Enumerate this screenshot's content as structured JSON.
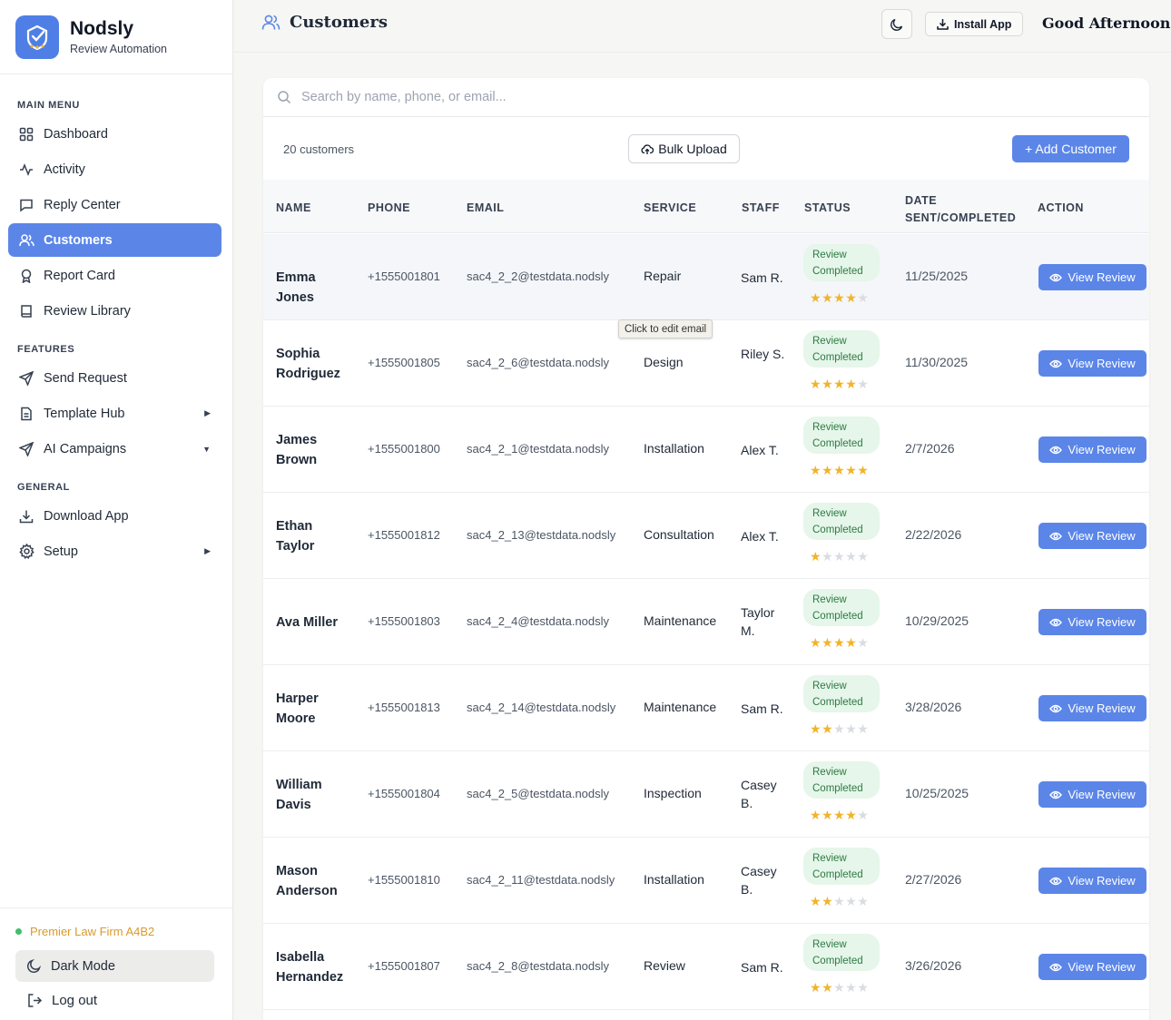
{
  "brand": {
    "name": "Nodsly",
    "subtitle": "Review Automation"
  },
  "sidebar": {
    "sections": [
      {
        "label": "MAIN MENU"
      },
      {
        "label": "FEATURES"
      },
      {
        "label": "GENERAL"
      }
    ],
    "items": [
      {
        "label": "Dashboard",
        "icon": "grid-icon"
      },
      {
        "label": "Activity",
        "icon": "activity-icon"
      },
      {
        "label": "Reply Center",
        "icon": "message-icon"
      },
      {
        "label": "Customers",
        "icon": "users-icon",
        "active": true
      },
      {
        "label": "Report Card",
        "icon": "award-icon"
      },
      {
        "label": "Review Library",
        "icon": "book-icon"
      },
      {
        "label": "Send Request",
        "icon": "send-icon"
      },
      {
        "label": "Template Hub",
        "icon": "file-icon"
      },
      {
        "label": "AI Campaigns",
        "icon": "send-icon"
      },
      {
        "label": "Download App",
        "icon": "download-icon"
      },
      {
        "label": "Setup",
        "icon": "gear-icon"
      }
    ],
    "firm": "Premier Law Firm A4B2",
    "dark_mode": "Dark Mode",
    "logout": "Log out"
  },
  "header": {
    "title": "Customers",
    "install": "Install App",
    "greeting": "Good Afternoon!"
  },
  "toolbar": {
    "search_placeholder": "Search by name, phone, or email...",
    "count": "20 customers",
    "bulk_upload": "Bulk Upload",
    "add_customer": "+ Add Customer"
  },
  "table": {
    "columns": [
      "NAME",
      "PHONE",
      "EMAIL",
      "SERVICE",
      "STAFF",
      "STATUS",
      "DATE SENT/COMPLETED",
      "ACTION"
    ],
    "rows": [
      {
        "name": "Emma Jones",
        "phone": "+1555001801",
        "email": "sac4_2_2@testdata.nodsly",
        "service": "Repair",
        "staff": "Sam R.",
        "status": "Review Completed",
        "rating": 4,
        "date": "11/25/2025",
        "action": "View Review"
      },
      {
        "name": "Sophia Rodriguez",
        "phone": "+1555001805",
        "email": "sac4_2_6@testdata.nodsly",
        "service": "Design",
        "staff": "Riley S.",
        "status": "Review Completed",
        "rating": 4,
        "date": "11/30/2025",
        "action": "View Review"
      },
      {
        "name": "James Brown",
        "phone": "+1555001800",
        "email": "sac4_2_1@testdata.nodsly",
        "service": "Installation",
        "staff": "Alex T.",
        "status": "Review Completed",
        "rating": 5,
        "date": "2/7/2026",
        "action": "View Review"
      },
      {
        "name": "Ethan Taylor",
        "phone": "+1555001812",
        "email": "sac4_2_13@testdata.nodsly",
        "service": "Consultation",
        "staff": "Alex T.",
        "status": "Review Completed",
        "rating": 1,
        "date": "2/22/2026",
        "action": "View Review"
      },
      {
        "name": "Ava Miller",
        "phone": "+1555001803",
        "email": "sac4_2_4@testdata.nodsly",
        "service": "Maintenance",
        "staff": "Taylor M.",
        "status": "Review Completed",
        "rating": 4,
        "date": "10/29/2025",
        "action": "View Review"
      },
      {
        "name": "Harper Moore",
        "phone": "+1555001813",
        "email": "sac4_2_14@testdata.nodsly",
        "service": "Maintenance",
        "staff": "Sam R.",
        "status": "Review Completed",
        "rating": 2,
        "date": "3/28/2026",
        "action": "View Review"
      },
      {
        "name": "William Davis",
        "phone": "+1555001804",
        "email": "sac4_2_5@testdata.nodsly",
        "service": "Inspection",
        "staff": "Casey B.",
        "status": "Review Completed",
        "rating": 4,
        "date": "10/25/2025",
        "action": "View Review"
      },
      {
        "name": "Mason Anderson",
        "phone": "+1555001810",
        "email": "sac4_2_11@testdata.nodsly",
        "service": "Installation",
        "staff": "Casey B.",
        "status": "Review Completed",
        "rating": 2,
        "date": "2/27/2026",
        "action": "View Review"
      },
      {
        "name": "Isabella Hernandez",
        "phone": "+1555001807",
        "email": "sac4_2_8@testdata.nodsly",
        "service": "Review",
        "staff": "Sam R.",
        "status": "Review Completed",
        "rating": 2,
        "date": "3/26/2026",
        "action": "View Review"
      }
    ]
  },
  "tooltip": "Click to edit email",
  "colors": {
    "accent": "#5b86e8",
    "status_bg": "#e6f6ea",
    "status_text": "#2d7a43",
    "star": "#f0b429",
    "firm": "#d99a2b"
  }
}
